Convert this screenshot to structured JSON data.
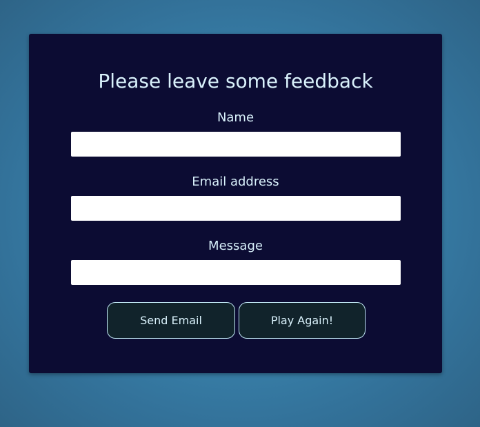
{
  "form": {
    "title": "Please leave some feedback",
    "fields": [
      {
        "label": "Name",
        "value": "",
        "placeholder": ""
      },
      {
        "label": "Email address",
        "value": "",
        "placeholder": ""
      },
      {
        "label": "Message",
        "value": "",
        "placeholder": ""
      }
    ],
    "buttons": {
      "send": "Send Email",
      "play_again": "Play Again!"
    }
  },
  "colors": {
    "background": "#3a86b0",
    "card": "#0c0c33",
    "text": "#d9f1fb",
    "button_bg": "#11232b",
    "button_border": "#bfe6f3",
    "input_bg": "#ffffff"
  }
}
